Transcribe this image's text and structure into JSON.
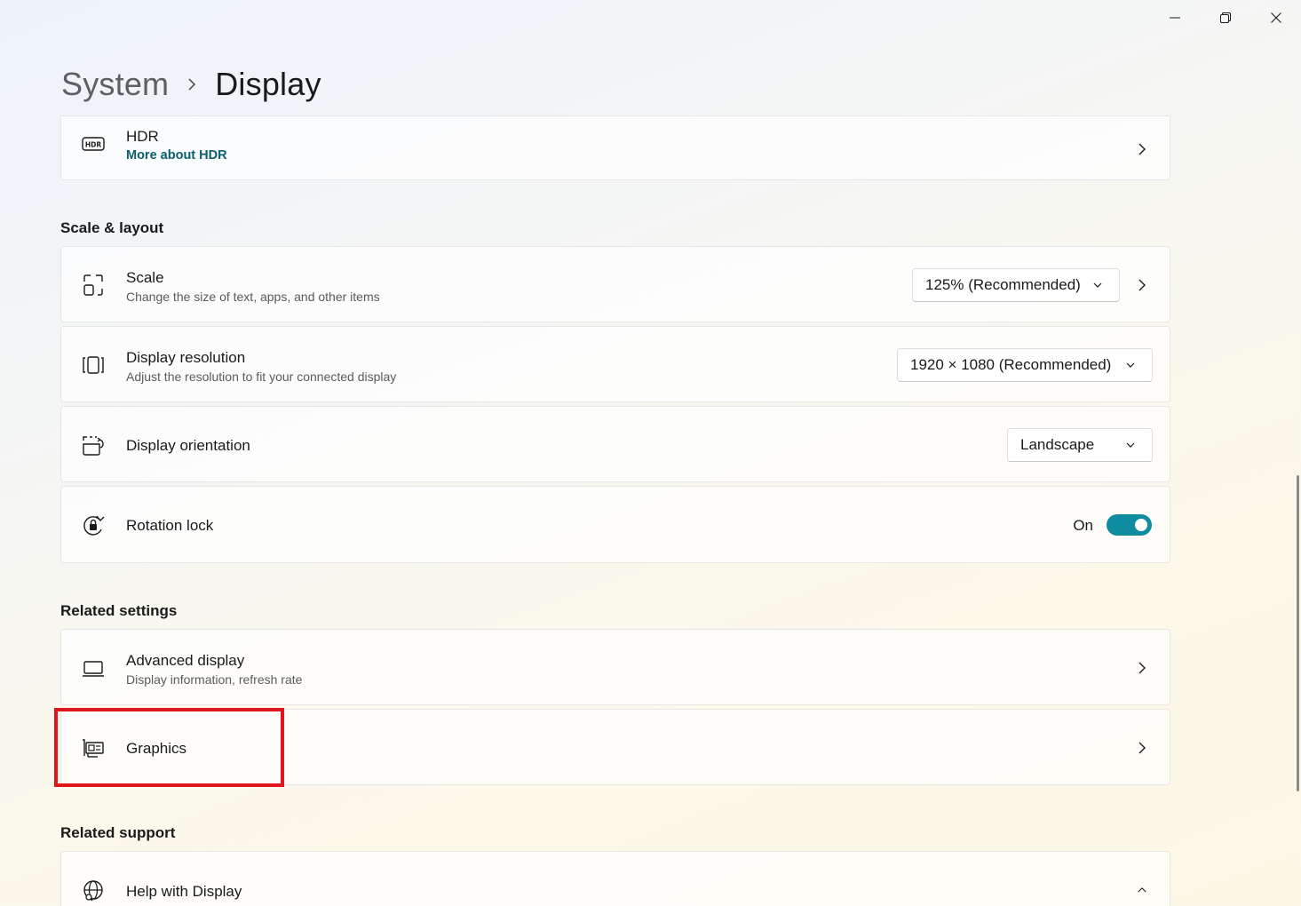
{
  "breadcrumb": {
    "parent": "System",
    "current": "Display"
  },
  "hdr": {
    "title": "HDR",
    "link": "More about HDR"
  },
  "sections": {
    "scale_layout": "Scale & layout",
    "related_settings": "Related settings",
    "related_support": "Related support"
  },
  "scale": {
    "title": "Scale",
    "subtitle": "Change the size of text, apps, and other items",
    "value": "125% (Recommended)"
  },
  "resolution": {
    "title": "Display resolution",
    "subtitle": "Adjust the resolution to fit your connected display",
    "value": "1920 × 1080 (Recommended)"
  },
  "orientation": {
    "title": "Display orientation",
    "value": "Landscape"
  },
  "rotation_lock": {
    "title": "Rotation lock",
    "state": "On"
  },
  "advanced": {
    "title": "Advanced display",
    "subtitle": "Display information, refresh rate"
  },
  "graphics": {
    "title": "Graphics"
  },
  "help": {
    "title": "Help with Display"
  },
  "colors": {
    "accent": "#0f8ca0",
    "link": "#0b5f6d",
    "highlight": "#e0161c"
  }
}
